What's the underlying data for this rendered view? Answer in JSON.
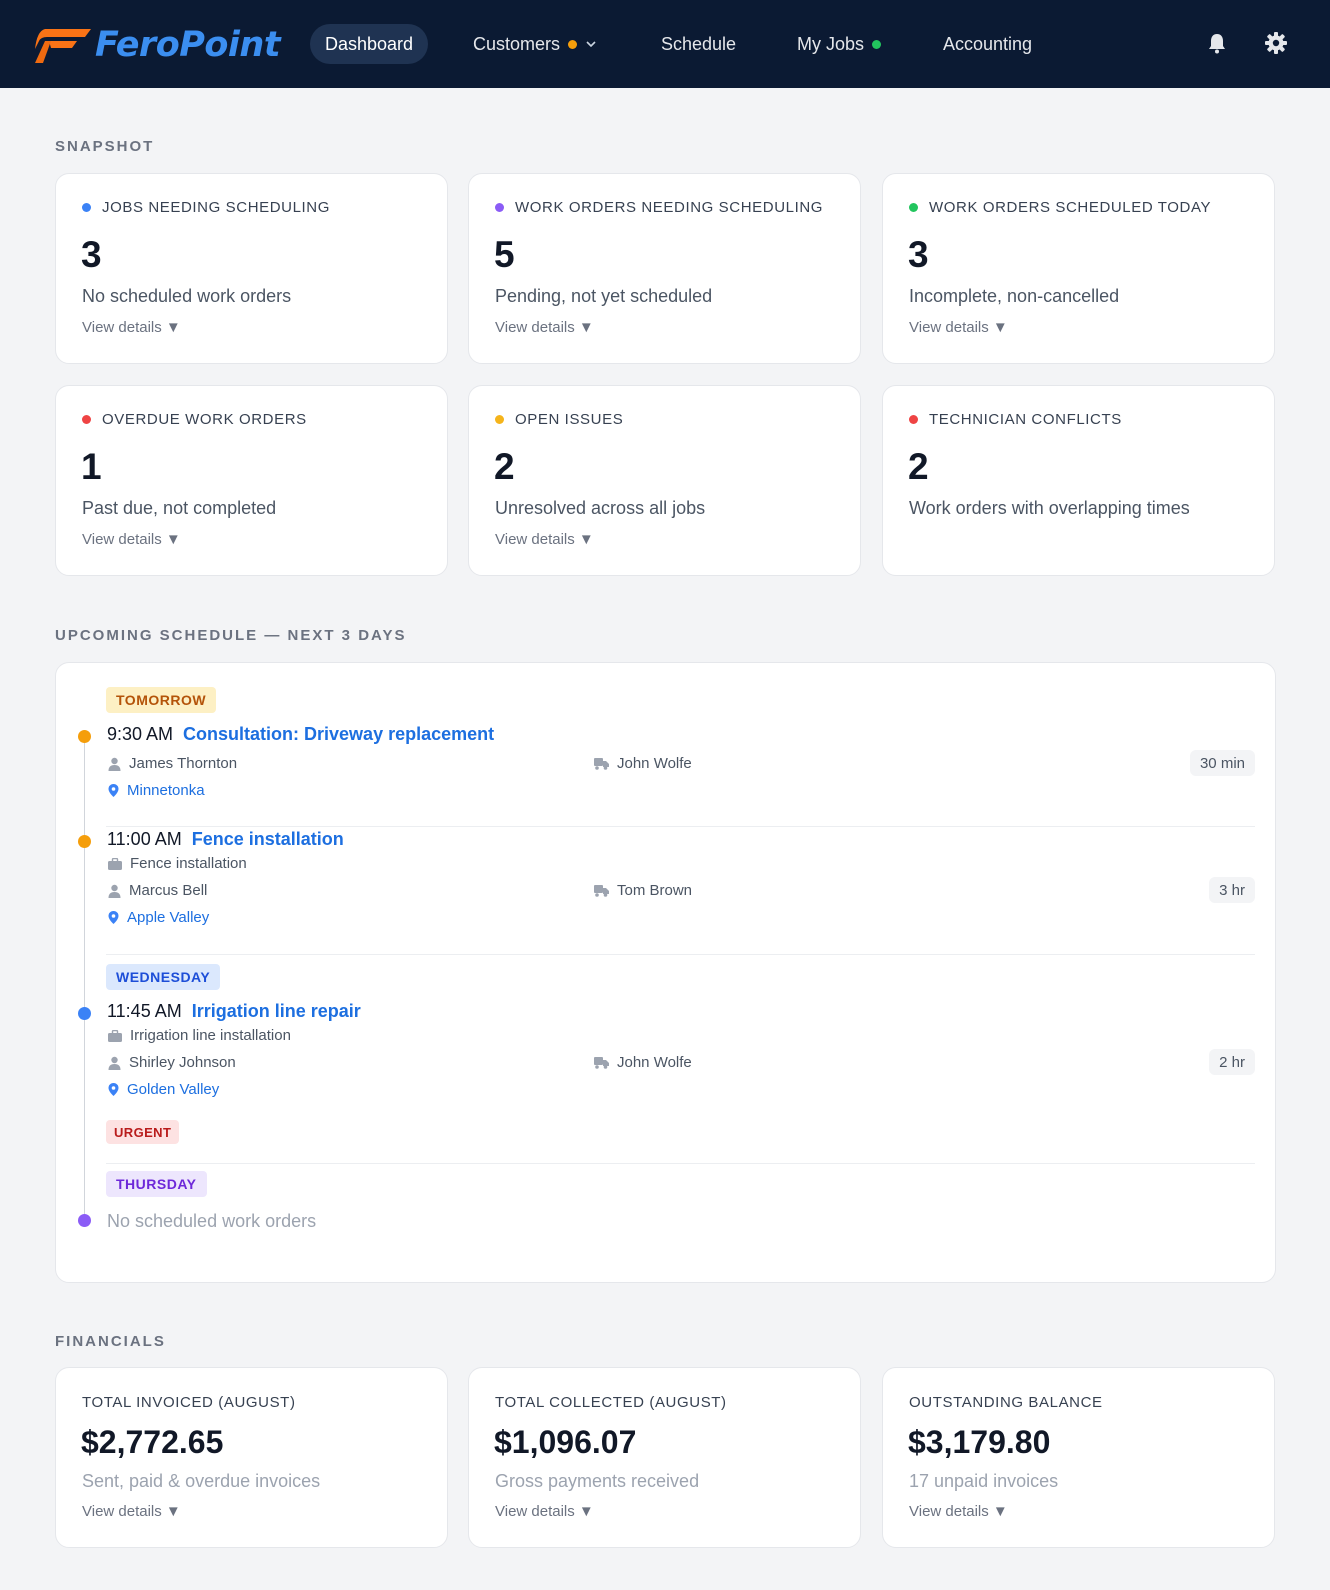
{
  "app": {
    "brand": "FeroPoint",
    "nav": {
      "dashboard": "Dashboard",
      "customers": "Customers",
      "schedule": "Schedule",
      "my_jobs": "My Jobs",
      "accounting": "Accounting"
    },
    "colors": {
      "nav_bg": "#0b1a33",
      "brand_blue": "#3b8ef0",
      "brand_orange": "#f97316"
    }
  },
  "snapshot": {
    "title": "SNAPSHOT",
    "cards": [
      {
        "label": "JOBS NEEDING SCHEDULING",
        "value": "3",
        "sub": "No scheduled work orders",
        "link": "View details ▼",
        "dot": "#3b82f6"
      },
      {
        "label": "WORK ORDERS NEEDING SCHEDULING",
        "value": "5",
        "sub": "Pending, not yet scheduled",
        "link": "View details ▼",
        "dot": "#8b5cf6"
      },
      {
        "label": "WORK ORDERS SCHEDULED TODAY",
        "value": "3",
        "sub": "Incomplete, non-cancelled",
        "link": "View details ▼",
        "dot": "#22c55e"
      },
      {
        "label": "OVERDUE WORK ORDERS",
        "value": "1",
        "sub": "Past due, not completed",
        "link": "View details ▼",
        "dot": "#ef4444"
      },
      {
        "label": "OPEN ISSUES",
        "value": "2",
        "sub": "Unresolved across all jobs",
        "link": "View details ▼",
        "dot": "#f5b41b"
      },
      {
        "label": "TECHNICIAN CONFLICTS",
        "value": "2",
        "sub": "Work orders with overlapping times",
        "dot": "#ef4444"
      }
    ]
  },
  "schedule": {
    "title": "UPCOMING SCHEDULE — NEXT 3 DAYS",
    "days": {
      "tomorrow": "TOMORROW",
      "wednesday": "WEDNESDAY",
      "thursday": "THURSDAY"
    },
    "entries": [
      {
        "time": "9:30 AM",
        "title": "Consultation: Driveway replacement",
        "customer": "James Thornton",
        "location": "Minnetonka",
        "tech": "John Wolfe",
        "duration": "30 min"
      },
      {
        "time": "11:00 AM",
        "title": "Fence installation",
        "job_type": "Fence installation",
        "customer": "Marcus Bell",
        "location": "Apple Valley",
        "tech": "Tom Brown",
        "duration": "3 hr"
      },
      {
        "time": "11:45 AM",
        "title": "Irrigation line repair",
        "job_type": "Irrigation line installation",
        "customer": "Shirley Johnson",
        "location": "Golden Valley",
        "tech": "John Wolfe",
        "duration": "2 hr",
        "tag": "URGENT"
      }
    ],
    "empty_text": "No scheduled work orders"
  },
  "financials": {
    "title": "FINANCIALS",
    "cards": [
      {
        "label": "TOTAL INVOICED (AUGUST)",
        "value": "$2,772.65",
        "sub": "Sent, paid & overdue invoices",
        "link": "View details ▼"
      },
      {
        "label": "TOTAL COLLECTED (AUGUST)",
        "value": "$1,096.07",
        "sub": "Gross payments received",
        "link": "View details ▼"
      },
      {
        "label": "OUTSTANDING BALANCE",
        "value": "$3,179.80",
        "sub": "17 unpaid invoices",
        "link": "View details ▼"
      }
    ]
  }
}
